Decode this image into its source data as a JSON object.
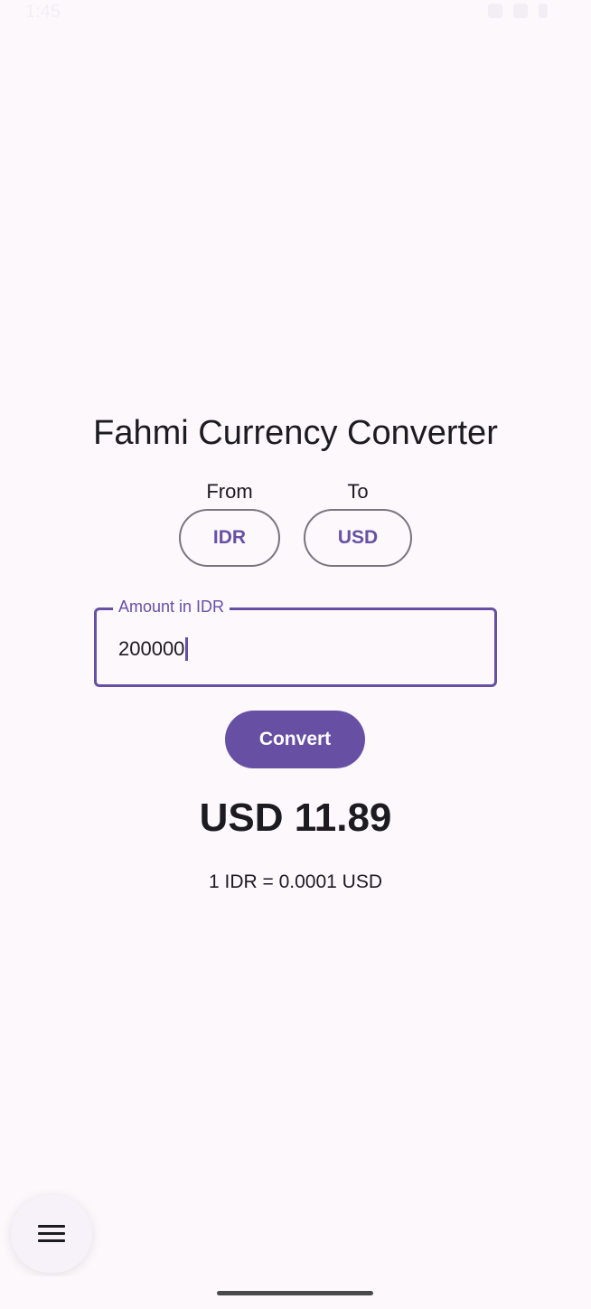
{
  "status_bar": {
    "time": "1:45"
  },
  "app": {
    "title": "Fahmi Currency Converter"
  },
  "selector": {
    "from_label": "From",
    "to_label": "To",
    "from_currency": "IDR",
    "to_currency": "USD"
  },
  "amount_field": {
    "label": "Amount in IDR",
    "value": "200000"
  },
  "convert_button": {
    "label": "Convert"
  },
  "result": {
    "converted": "USD 11.89",
    "rate": "1 IDR = 0.0001 USD"
  },
  "fab": {
    "icon": "menu-icon"
  },
  "colors": {
    "accent": "#6750a4",
    "background": "#fdf8fc",
    "outline": "#79747e",
    "text": "#1c1b1f"
  }
}
